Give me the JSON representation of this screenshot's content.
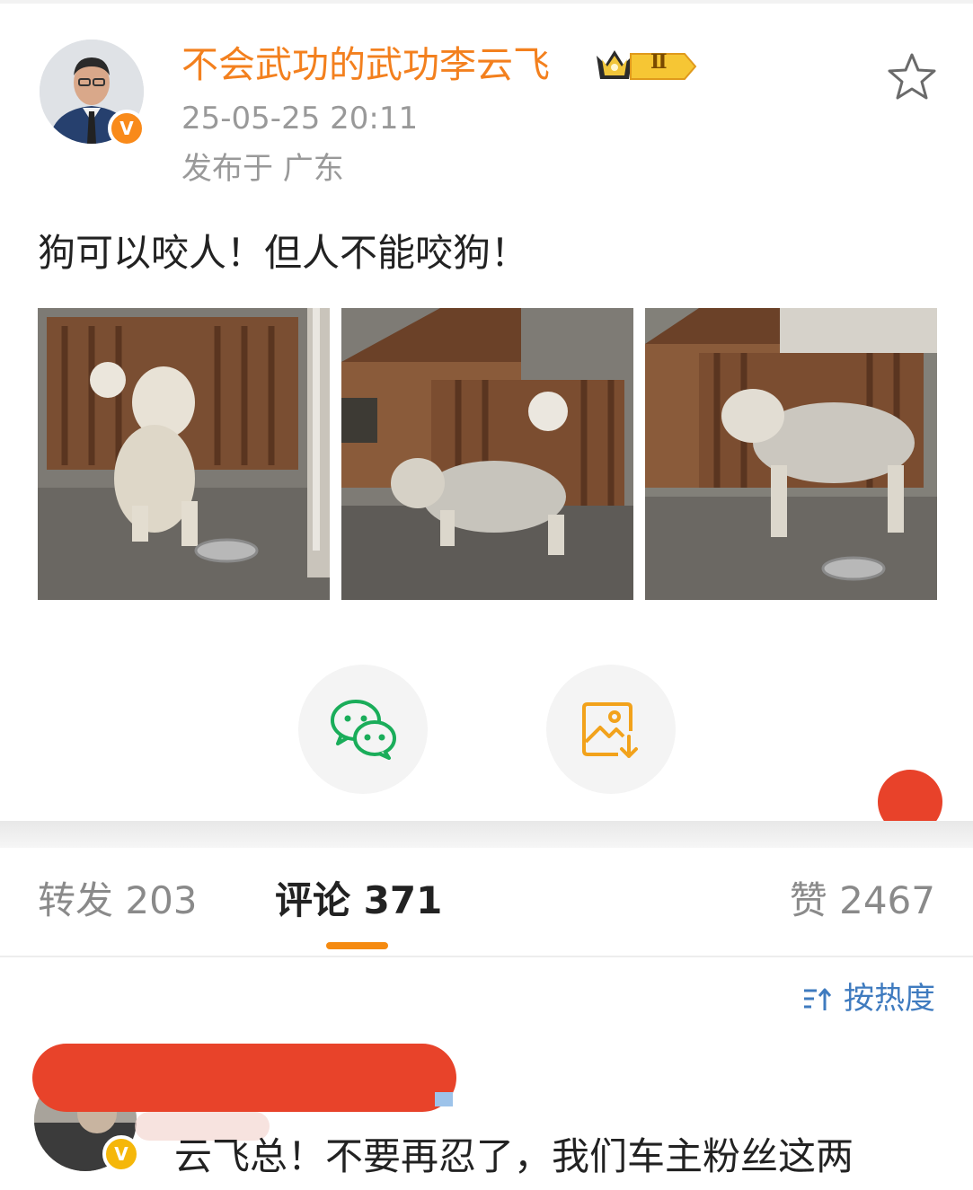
{
  "post": {
    "author": "不会武功的武功李云飞",
    "level_badge": "Ⅱ",
    "timestamp": "25-05-25 20:11",
    "location": "发布于 广东",
    "text": "狗可以咬人！但人不能咬狗！",
    "photos": [
      "dog-photo-1",
      "dog-photo-2",
      "dog-photo-3"
    ]
  },
  "share": {
    "wechat_icon": "wechat-icon",
    "save_icon": "save-image-icon"
  },
  "tabs": {
    "repost": "转发 203",
    "comment": "评论 371",
    "like": "赞 2467"
  },
  "sort": {
    "label": "按热度"
  },
  "comment": {
    "text": "云飞总！不要再忍了，我们车主粉丝这两"
  },
  "colors": {
    "accent": "#f3801e",
    "link": "#3f7bbf",
    "tab_indicator": "#f58a10",
    "notification_dot": "#e8422a"
  }
}
